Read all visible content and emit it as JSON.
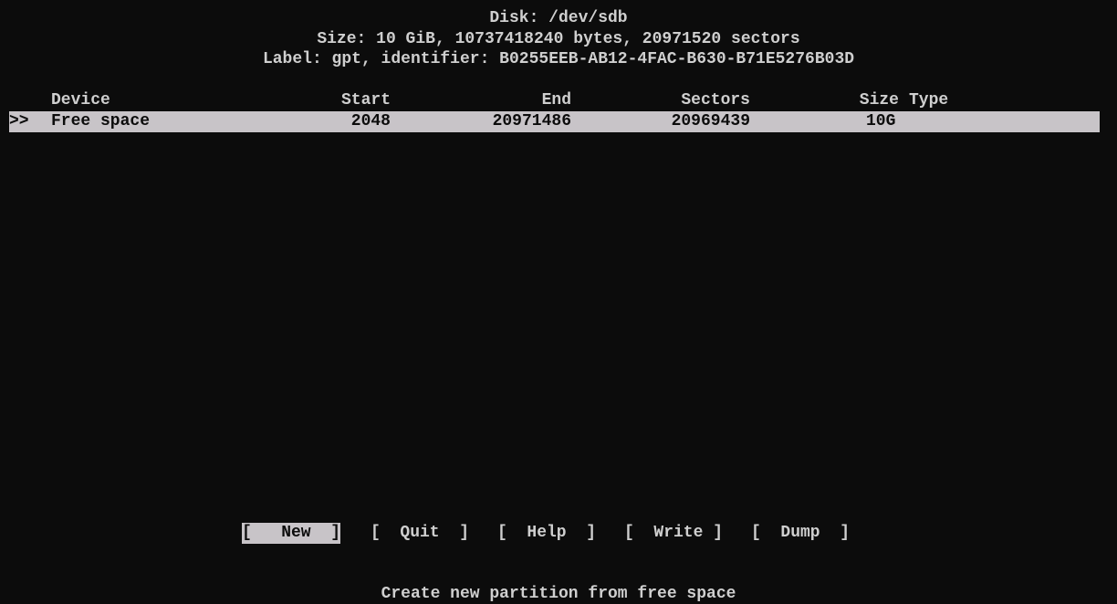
{
  "disk": {
    "title": "Disk: /dev/sdb",
    "size_line": "Size: 10 GiB, 10737418240 bytes, 20971520 sectors",
    "label_line": "Label: gpt, identifier: B0255EEB-AB12-4FAC-B630-B71E5276B03D"
  },
  "table": {
    "columns": {
      "device": "Device",
      "start": "Start",
      "end": "End",
      "sectors": "Sectors",
      "size": "Size",
      "type": "Type"
    },
    "rows": [
      {
        "marker": ">>",
        "device": "Free space",
        "start": "2048",
        "end": "20971486",
        "sectors": "20969439",
        "size": "10G",
        "type": ""
      }
    ]
  },
  "menu": {
    "items": [
      {
        "label": "[   New  ]",
        "selected": true
      },
      {
        "label": "[  Quit  ]",
        "selected": false
      },
      {
        "label": "[  Help  ]",
        "selected": false
      },
      {
        "label": "[  Write ]",
        "selected": false
      },
      {
        "label": "[  Dump  ]",
        "selected": false
      }
    ]
  },
  "status": {
    "text": "Create new partition from free space"
  },
  "colors": {
    "background": "#0c0c0c",
    "foreground": "#cfcfcf",
    "highlight": "#c8c4c8"
  }
}
